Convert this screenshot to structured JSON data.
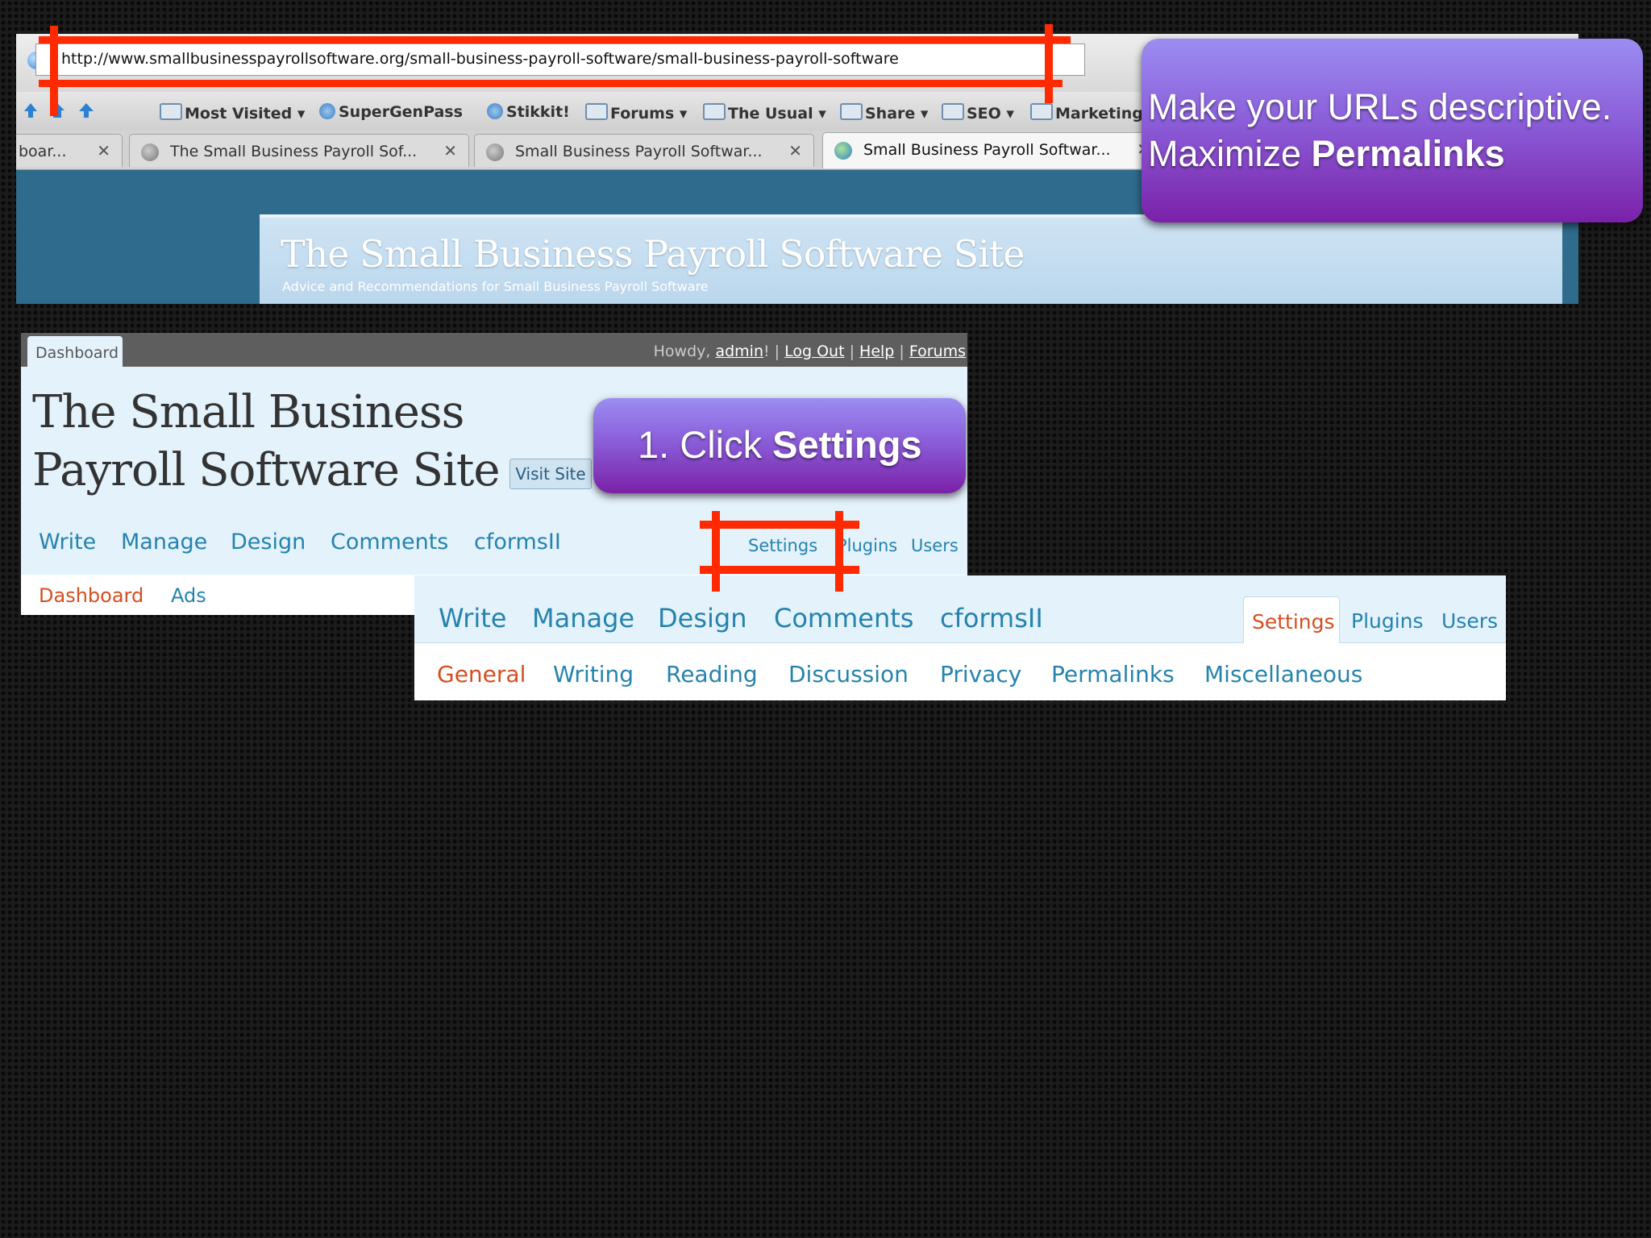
{
  "browser": {
    "url": "http://www.smallbusinesspayrollsoftware.org/small-business-payroll-software/small-business-payroll-software",
    "bookmarks": [
      "Most Visited ▾",
      "SuperGenPass",
      "Stikkit!",
      "Forums ▾",
      "The Usual ▾",
      "Share ▾",
      "SEO ▾",
      "Marketing"
    ],
    "tabs": [
      {
        "label": "boar...",
        "close": "✕"
      },
      {
        "label": "The Small Business Payroll Sof...",
        "close": "✕"
      },
      {
        "label": "Small Business Payroll Softwar...",
        "close": "✕"
      },
      {
        "label": "Small Business Payroll Softwar...",
        "close": "✕"
      }
    ],
    "site_title": "The Small Business Payroll Software Site",
    "site_tagline": "Advice and Recommendations for Small Business Payroll Software"
  },
  "callouts": {
    "top_line1": "Make your URLs descriptive.",
    "top_line2_prefix": "Maximize ",
    "top_line2_bold": "Permalinks",
    "settings_prefix": "1. Click ",
    "settings_bold": "Settings"
  },
  "wp1": {
    "dashboard_tab": "Dashboard",
    "howdy": "Howdy, ",
    "user": "admin",
    "exclaim": "! | ",
    "logout": "Log Out",
    "sep": " | ",
    "help": "Help",
    "forums": "Forums",
    "title_line1": "The Small Business",
    "title_line2": "Payroll Software Site",
    "visit_site": "Visit Site",
    "nav": [
      "Write",
      "Manage",
      "Design",
      "Comments",
      "cformsII"
    ],
    "nav_right": [
      "Settings",
      "Plugins",
      "Users"
    ],
    "subnav": [
      "Dashboard",
      "Ads"
    ]
  },
  "wp2": {
    "nav": [
      "Write",
      "Manage",
      "Design",
      "Comments",
      "cformsII"
    ],
    "nav_right": [
      "Settings",
      "Plugins",
      "Users"
    ],
    "subnav": [
      "General",
      "Writing",
      "Reading",
      "Discussion",
      "Privacy",
      "Permalinks",
      "Miscellaneous"
    ]
  },
  "colors": {
    "highlight_red": "#ff2a00",
    "callout_purple": "#8b5ed9",
    "wp_link": "#2583ad",
    "wp_current": "#d54e21"
  }
}
